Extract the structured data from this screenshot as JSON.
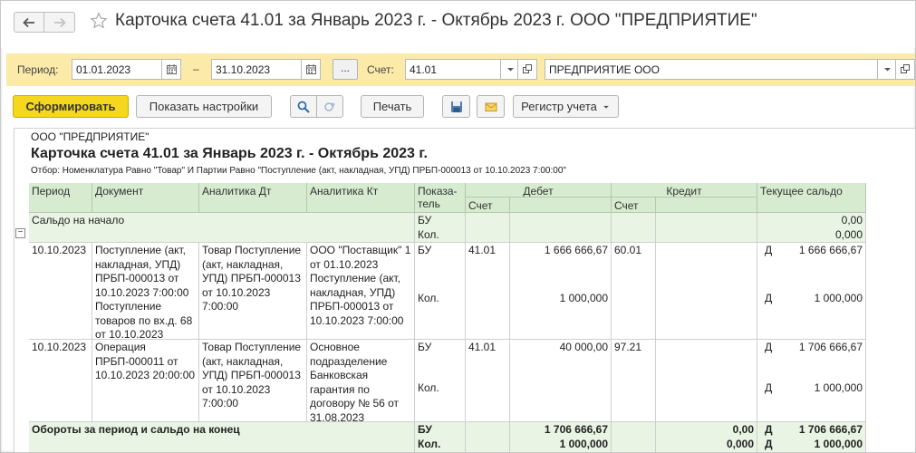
{
  "window": {
    "title": "Карточка счета 41.01 за Январь 2023 г. - Октябрь 2023 г. ООО \"ПРЕДПРИЯТИЕ\""
  },
  "filters": {
    "period_label": "Период:",
    "date_from": "01.01.2023",
    "date_separator": "–",
    "date_to": "31.10.2023",
    "dots_label": "...",
    "account_label": "Счет:",
    "account_value": "41.01",
    "organization_value": "ПРЕДПРИЯТИЕ ООО"
  },
  "toolbar": {
    "generate_label": "Сформировать",
    "settings_label": "Показать настройки",
    "print_label": "Печать",
    "register_label": "Регистр учета"
  },
  "report": {
    "organization": "ООО \"ПРЕДПРИЯТИЕ\"",
    "title": "Карточка счета 41.01 за Январь 2023 г. - Октябрь 2023 г.",
    "selection": "Отбор: Номенклатура Равно \"Товар\" И Партии Равно \"Поступление (акт, накладная, УПД) ПРБП-000013 от 10.10.2023 7:00:00\"",
    "headers": {
      "period": "Период",
      "document": "Документ",
      "analytics_dt": "Аналитика Дт",
      "analytics_kt": "Аналитика Кт",
      "indicator_1": "Показа-",
      "indicator_2": "тель",
      "debit": "Дебет",
      "credit": "Кредит",
      "balance": "Текущее сальдо",
      "account_dt": "Счет",
      "account_kt": "Счет"
    },
    "opening": {
      "label": "Сальдо на начало",
      "ind_bu": "БУ",
      "ind_kol": "Кол.",
      "value_bu": "0,00",
      "value_kol": "0,000"
    },
    "rows": [
      {
        "period": "10.10.2023",
        "document": "Поступление (акт, накладная, УПД) ПРБП-000013 от 10.10.2023 7:00:00 Поступление товаров по вх.д. 68 от 10.10.2023",
        "analytics_dt": "Товар Поступление (акт, накладная, УПД) ПРБП-000013 от 10.10.2023 7:00:00",
        "analytics_kt": "ООО \"Поставщик\" 1 от 01.10.2023 Поступление (акт, накладная, УПД) ПРБП-000013 от 10.10.2023 7:00:00",
        "ind_bu": "БУ",
        "ind_kol": "Кол.",
        "debit_account": "41.01",
        "debit_bu": "1 666 666,67",
        "debit_kol": "1 000,000",
        "credit_account": "60.01",
        "credit_bu": "",
        "credit_kol": "",
        "bal_dir_bu": "Д",
        "bal_bu": "1 666 666,67",
        "bal_dir_kol": "Д",
        "bal_kol": "1 000,000"
      },
      {
        "period": "10.10.2023",
        "document": "Операция ПРБП-000011 от 10.10.2023 20:00:00",
        "analytics_dt": "Товар Поступление (акт, накладная, УПД) ПРБП-000013 от 10.10.2023 7:00:00",
        "analytics_kt": "Основное подразделение Банковская гарантия по договору № 56 от 31.08.2023",
        "ind_bu": "БУ",
        "ind_kol": "Кол.",
        "debit_account": "41.01",
        "debit_bu": "40 000,00",
        "debit_kol": "",
        "credit_account": "97.21",
        "credit_bu": "",
        "credit_kol": "",
        "bal_dir_bu": "Д",
        "bal_bu": "1 706 666,67",
        "bal_dir_kol": "Д",
        "bal_kol": "1 000,000"
      }
    ],
    "totals": {
      "label": "Обороты за период и сальдо на конец",
      "ind_bu": "БУ",
      "ind_kol": "Кол.",
      "debit_bu": "1 706 666,67",
      "debit_kol": "1 000,000",
      "credit_bu": "0,00",
      "credit_kol": "0,000",
      "bal_dir_bu": "Д",
      "bal_bu": "1 706 666,67",
      "bal_dir_kol": "Д",
      "bal_kol": "1 000,000"
    }
  },
  "colors": {
    "accent_button": "#f6d71f",
    "filter_panel": "#fbeaa8",
    "table_header": "#d6ebd0",
    "group_row": "#e9f4e4"
  },
  "icons": [
    "arrow-left-icon",
    "arrow-right-icon",
    "star-icon",
    "calendar-icon",
    "dropdown-arrow-icon",
    "open-link-icon",
    "search-icon",
    "refresh-icon",
    "save-icon",
    "envelope-icon",
    "collapse-icon"
  ]
}
